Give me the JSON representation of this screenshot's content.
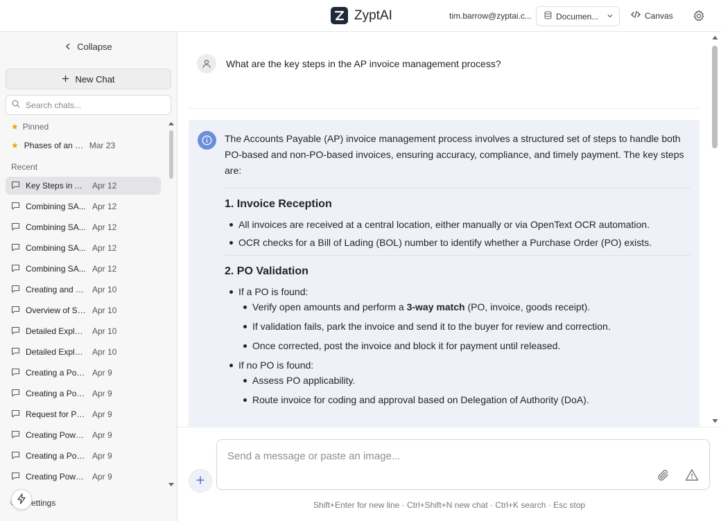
{
  "app": {
    "name": "ZyptAI"
  },
  "header": {
    "user_email": "tim.barrow@zyptai.c...",
    "documents_label": "Documen...",
    "canvas_label": "Canvas"
  },
  "sidebar": {
    "collapse_label": "Collapse",
    "new_chat_label": "New Chat",
    "search_placeholder": "Search chats...",
    "pinned_label": "Pinned",
    "pinned_items": [
      {
        "title": "Phases of an S...",
        "date": "Mar 23"
      }
    ],
    "recent_label": "Recent",
    "recent_items": [
      {
        "title": "Key Steps in AP...",
        "date": "Apr 12"
      },
      {
        "title": "Combining SA...",
        "date": "Apr 12"
      },
      {
        "title": "Combining SA...",
        "date": "Apr 12"
      },
      {
        "title": "Combining SA...",
        "date": "Apr 12"
      },
      {
        "title": "Combining SA...",
        "date": "Apr 12"
      },
      {
        "title": "Creating and E...",
        "date": "Apr 10"
      },
      {
        "title": "Overview of SA...",
        "date": "Apr 10"
      },
      {
        "title": "Detailed Explan...",
        "date": "Apr 10"
      },
      {
        "title": "Detailed Explan...",
        "date": "Apr 10"
      },
      {
        "title": "Creating a Powe...",
        "date": "Apr 9"
      },
      {
        "title": "Creating a Powe...",
        "date": "Apr 9"
      },
      {
        "title": "Request for Pow...",
        "date": "Apr 9"
      },
      {
        "title": "Creating PowerP...",
        "date": "Apr 9"
      },
      {
        "title": "Creating a Powe...",
        "date": "Apr 9"
      },
      {
        "title": "Creating PowerP...",
        "date": "Apr 9"
      }
    ],
    "settings_label": "Settings"
  },
  "conversation": {
    "user_message": "What are the key steps in the AP invoice management process?",
    "assistant": {
      "intro": "The Accounts Payable (AP) invoice management process involves a structured set of steps to handle both PO-based and non-PO-based invoices, ensuring accuracy, compliance, and timely payment. The key steps are:",
      "section1": {
        "heading": "1. Invoice Reception",
        "bullets": [
          "All invoices are received at a central location, either manually or via OpenText OCR automation.",
          "OCR checks for a Bill of Lading (BOL) number to identify whether a Purchase Order (PO) exists."
        ]
      },
      "section2": {
        "heading": "2. PO Validation",
        "po_found": "If a PO is found:",
        "po_found_sub": {
          "verify_before": "Verify open amounts and perform a ",
          "verify_bold": "3-way match",
          "verify_after": " (PO, invoice, goods receipt).",
          "park": "If validation fails, park the invoice and send it to the buyer for review and correction.",
          "post": "Once corrected, post the invoice and block it for payment until released."
        },
        "no_po": "If no PO is found:",
        "no_po_sub": [
          "Assess PO applicability.",
          "Route invoice for coding and approval based on Delegation of Authority (DoA)."
        ]
      }
    }
  },
  "composer": {
    "placeholder": "Send a message or paste an image...",
    "hint": "Shift+Enter for new line · Ctrl+Shift+N new chat · Ctrl+K search · Esc stop"
  }
}
